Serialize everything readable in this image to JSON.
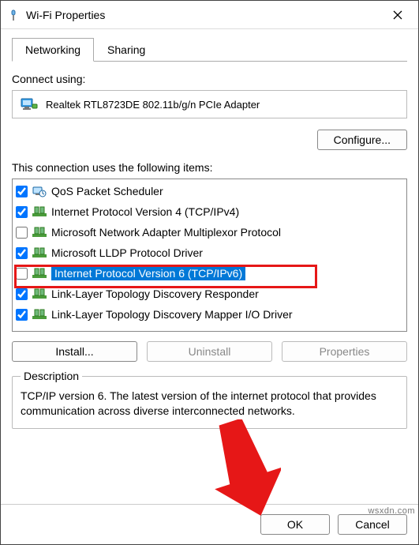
{
  "titlebar": {
    "title": "Wi-Fi Properties"
  },
  "tabs": {
    "networking": "Networking",
    "sharing": "Sharing"
  },
  "connect_using_label": "Connect using:",
  "adapter_name": "Realtek RTL8723DE 802.11b/g/n PCIe Adapter",
  "configure_label": "Configure...",
  "items_label": "This connection uses the following items:",
  "items": [
    {
      "checked": true,
      "icon": "sched",
      "label": "QoS Packet Scheduler"
    },
    {
      "checked": true,
      "icon": "proto",
      "label": "Internet Protocol Version 4 (TCP/IPv4)"
    },
    {
      "checked": false,
      "icon": "proto",
      "label": "Microsoft Network Adapter Multiplexor Protocol"
    },
    {
      "checked": true,
      "icon": "proto",
      "label": "Microsoft LLDP Protocol Driver"
    },
    {
      "checked": false,
      "icon": "proto",
      "label": "Internet Protocol Version 6 (TCP/IPv6)",
      "selected": true
    },
    {
      "checked": true,
      "icon": "proto",
      "label": "Link-Layer Topology Discovery Responder"
    },
    {
      "checked": true,
      "icon": "proto",
      "label": "Link-Layer Topology Discovery Mapper I/O Driver"
    }
  ],
  "buttons": {
    "install": "Install...",
    "uninstall": "Uninstall",
    "properties": "Properties"
  },
  "description": {
    "legend": "Description",
    "text": "TCP/IP version 6. The latest version of the internet protocol that provides communication across diverse interconnected networks."
  },
  "footer": {
    "ok": "OK",
    "cancel": "Cancel"
  },
  "watermark": "wsxdn.com"
}
